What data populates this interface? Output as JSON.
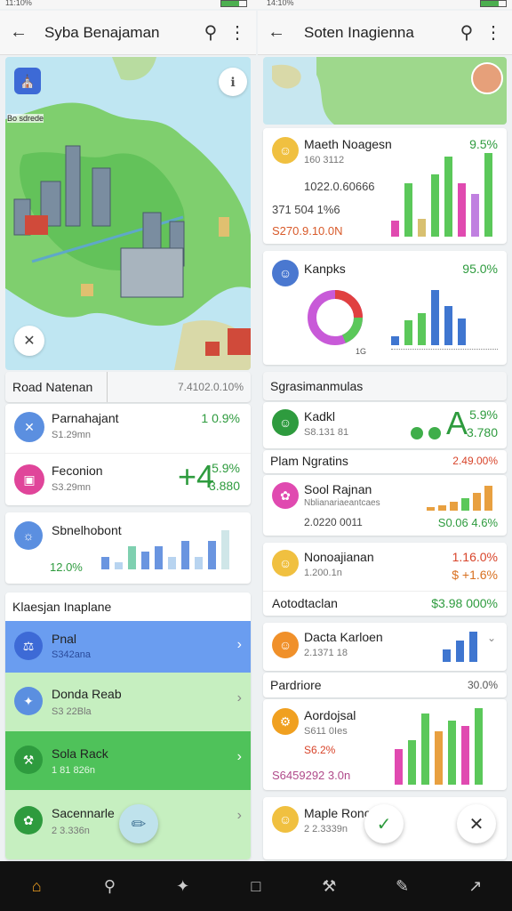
{
  "status": {
    "left_time": "11:10%",
    "right_time": "14:10%"
  },
  "left": {
    "title": "Syba Benajaman",
    "map": {
      "label_top": "Bo sdrede"
    },
    "panel_header": {
      "label": "Road Natenan",
      "value": "7.4102.0.10%"
    },
    "list1": [
      {
        "name": "Parnahajant",
        "sub": "S1.29mn",
        "value": "1 0.9%"
      },
      {
        "name": "Feconion",
        "sub": "S3.29mn",
        "value": "5.9%",
        "big": "+4",
        "big_sub": "3.880"
      }
    ],
    "chart_card": {
      "title": "Sbnelhobont",
      "value": "12.0%"
    },
    "section2": {
      "title": "Klaesjan Inaplane"
    },
    "list2": [
      {
        "name": "Pnal",
        "sub": "S342ana"
      },
      {
        "name": "Donda Reab",
        "sub": "S3 22Bla"
      },
      {
        "name": "Sola Rack",
        "sub": "1 81 826n"
      },
      {
        "name": "Sacennarle",
        "sub": "2 3.336n"
      }
    ]
  },
  "right": {
    "title": "Soten Inagienna",
    "card1": {
      "name": "Maeth Noagesn",
      "sub": "160 3112",
      "pct": "9.5%",
      "line1": "1022.0.60666",
      "line2": "371 504 1%6",
      "line3": "S270.9.10.0N"
    },
    "card2": {
      "name": "Kanpks",
      "pct": "95.0%",
      "foot": "1G"
    },
    "section1": {
      "title": "Sgrasimanmulas"
    },
    "card3": {
      "name": "Kadkl",
      "sub": "S8.131 81",
      "pct": "5.9%",
      "big": "A",
      "big_sub": "3.780"
    },
    "card4": {
      "title": "Plam Ngratins",
      "value": "2.49.00%"
    },
    "card5": {
      "name": "Sool Rajnan",
      "sub": "Nblianariaeantcaes",
      "line": "2.0220 0011",
      "value": "S0.06 4.6%"
    },
    "card6": {
      "name": "Nonoajianan",
      "sub": "1.200.1n",
      "pct": "1.16.0%",
      "pct2": "$ +1.6%",
      "foot_label": "Aotodtaclan",
      "foot_value": "$3.98 000%"
    },
    "card7": {
      "name": "Dacta Karloen",
      "sub": "2.1371 18"
    },
    "card8": {
      "title": "Pardriore",
      "value": "30.0%"
    },
    "card9": {
      "name": "Aordojsal",
      "sub": "S611 0Ies",
      "pct": "S6.2%",
      "line": "S6459292 3.0n"
    },
    "card10": {
      "name": "Maple Rono",
      "sub": "2 2.3339n"
    }
  },
  "nav": [
    "home-icon",
    "search-icon",
    "explore-icon",
    "square-icon",
    "tools-icon",
    "edit-icon",
    "share-icon"
  ]
}
